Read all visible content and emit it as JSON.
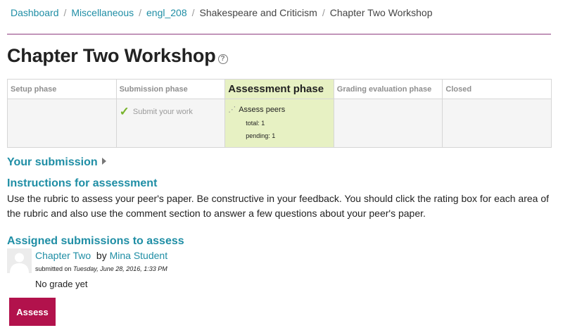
{
  "breadcrumb": {
    "items": [
      "Dashboard",
      "Miscellaneous",
      "engl_208",
      "Shakespeare and Criticism",
      "Chapter Two Workshop"
    ],
    "separator": "/"
  },
  "page": {
    "title": "Chapter Two Workshop",
    "help_icon": "help-icon"
  },
  "phases": [
    {
      "label": "Setup phase",
      "active": false
    },
    {
      "label": "Submission phase",
      "active": false,
      "task": "Submit your work",
      "task_done": true
    },
    {
      "label": "Assessment phase",
      "active": true,
      "task": "Assess peers",
      "info": [
        "total: 1",
        "pending: 1"
      ]
    },
    {
      "label": "Grading evaluation phase",
      "active": false
    },
    {
      "label": "Closed",
      "active": false
    }
  ],
  "your_submission": {
    "label": "Your submission"
  },
  "instructions": {
    "title": "Instructions for assessment",
    "body": "Use the rubric to assess your peer's paper. Be constructive in your feedback. You should click the rating box for each area of the rubric and also use the comment section to answer a few questions about your peer's paper."
  },
  "assigned": {
    "title": "Assigned submissions to assess",
    "submission_title": "Chapter Two",
    "by_label": "by",
    "author": "Mina Student",
    "submitted_label": "submitted on",
    "submitted_date": "Tuesday, June 28, 2016, 1:33 PM",
    "grade_status": "No grade yet",
    "assess_button": "Assess"
  },
  "colors": {
    "link": "#1f8ea5",
    "active_phase": "#e7f1c3",
    "button": "#b2124c",
    "rule": "#8e3b7e"
  }
}
